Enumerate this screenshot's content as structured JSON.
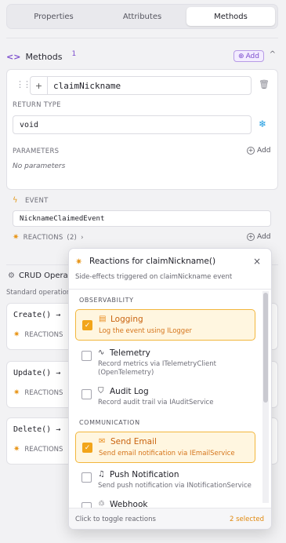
{
  "tabs": [
    {
      "label": "Properties",
      "active": false
    },
    {
      "label": "Attributes",
      "active": false
    },
    {
      "label": "Methods",
      "active": true
    }
  ],
  "methods": {
    "title": "Methods",
    "count": "1",
    "add_label": "Add",
    "method": {
      "plus_label": "+",
      "name": "claimNickname",
      "return_type_label": "RETURN TYPE",
      "return_type": "void",
      "parameters_label": "PARAMETERS",
      "parameters_add": "Add",
      "no_parameters": "No parameters",
      "event_label": "EVENT",
      "event_value": "NicknameClaimedEvent",
      "reactions_label": "REACTIONS",
      "reactions_count": "(2)",
      "reactions_add": "Add"
    }
  },
  "crud": {
    "title": "CRUD Operat",
    "subtitle": "Standard operation",
    "items": [
      {
        "name": "Create()",
        "reactions": "REACTIONS"
      },
      {
        "name": "Update()",
        "reactions": "REACTIONS"
      },
      {
        "name": "Delete()",
        "reactions": "REACTIONS"
      }
    ]
  },
  "popup": {
    "title": "Reactions for claimNickname()",
    "subtitle": "Side-effects triggered on claimNickname event",
    "groups": [
      {
        "label": "OBSERVABILITY",
        "options": [
          {
            "name": "Logging",
            "desc": "Log the event using ILogger",
            "selected": true,
            "icon": "document-icon"
          },
          {
            "name": "Telemetry",
            "desc": "Record metrics via ITelemetryClient (OpenTelemetry)",
            "selected": false,
            "icon": "activity-icon"
          },
          {
            "name": "Audit Log",
            "desc": "Record audit trail via IAuditService",
            "selected": false,
            "icon": "shield-icon"
          }
        ]
      },
      {
        "label": "COMMUNICATION",
        "options": [
          {
            "name": "Send Email",
            "desc": "Send email notification via IEmailService",
            "selected": true,
            "icon": "mail-icon"
          },
          {
            "name": "Push Notification",
            "desc": "Send push notification via INotificationService",
            "selected": false,
            "icon": "bell-icon"
          },
          {
            "name": "Webhook",
            "desc": "",
            "selected": false,
            "icon": "webhook-icon"
          }
        ]
      }
    ],
    "footer_hint": "Click to toggle reactions",
    "footer_selected": "2 selected"
  },
  "colors": {
    "accent_purple": "#7c4dce",
    "accent_orange": "#f2a51a",
    "link_blue": "#1e9be0"
  }
}
